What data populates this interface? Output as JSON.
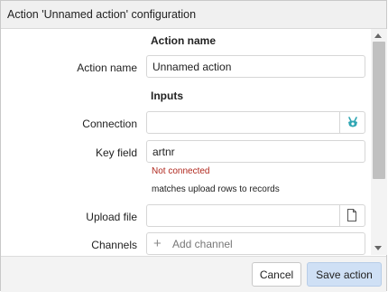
{
  "dialog": {
    "title": "Action 'Unnamed action' configuration"
  },
  "sections": {
    "action_name": "Action name",
    "inputs": "Inputs"
  },
  "fields": {
    "action_name": {
      "label": "Action name",
      "value": "Unnamed action"
    },
    "connection": {
      "label": "Connection",
      "value": "",
      "icon": "connector-icon"
    },
    "key_field": {
      "label": "Key field",
      "value": "artnr",
      "error": "Not connected",
      "hint": "matches upload rows to records"
    },
    "upload_file": {
      "label": "Upload file",
      "value": "",
      "icon": "file-icon"
    },
    "channels": {
      "label": "Channels",
      "placeholder": "Add channel",
      "icon": "plus-icon"
    }
  },
  "footer": {
    "cancel_label": "Cancel",
    "save_label": "Save action"
  },
  "colors": {
    "accent_button": "#cfe0f5",
    "error_text": "#b0281e",
    "connector_icon": "#2fa6b3"
  }
}
